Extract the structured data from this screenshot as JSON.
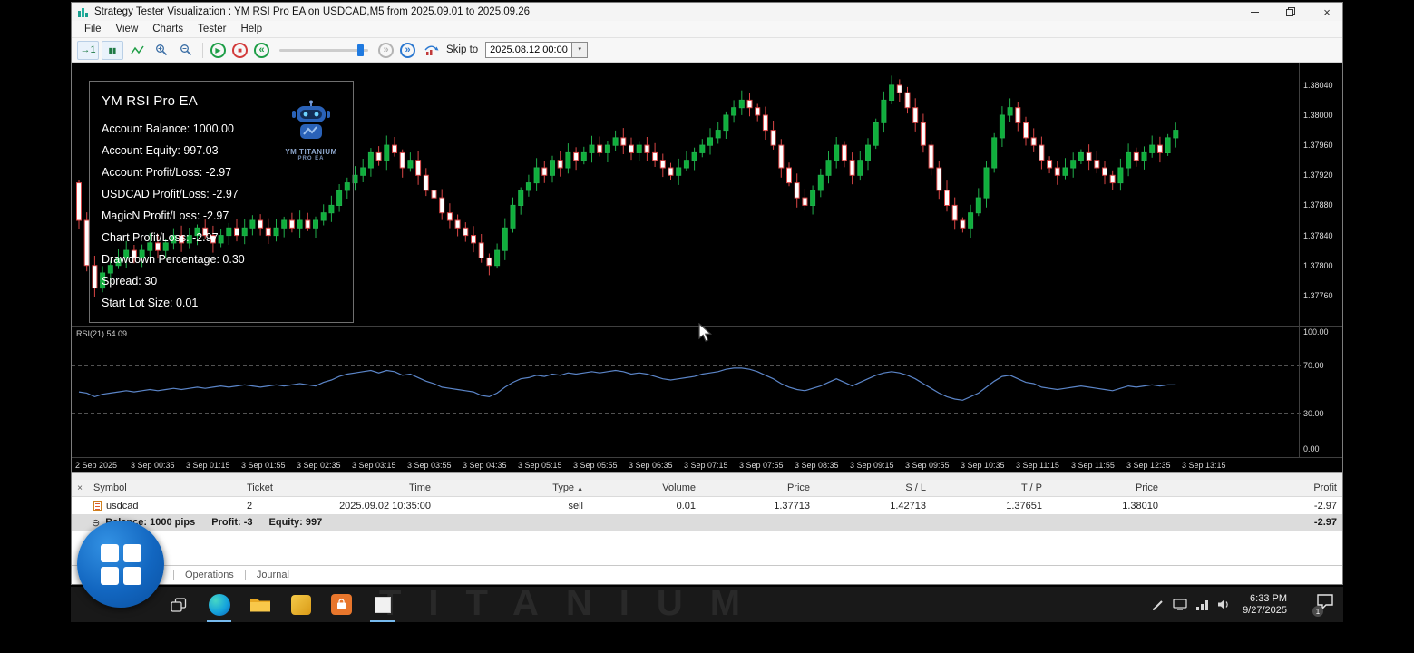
{
  "titlebar": {
    "title": "Strategy Tester Visualization : YM RSI Pro EA on USDCAD,M5 from 2025.09.01 to 2025.09.26"
  },
  "icons": {
    "close": "×",
    "table_close": "×",
    "sort_asc": "▲",
    "collapse": "⊖",
    "step": "→1",
    "pause": "▮▮",
    "play": "▶",
    "stop": "■",
    "rewind": "«",
    "forward": "»",
    "skip_end": "»",
    "dropdown": "▼"
  },
  "menu": {
    "items": [
      "File",
      "View",
      "Charts",
      "Tester",
      "Help"
    ]
  },
  "toolbar": {
    "skip_to": "Skip to",
    "date_value": "2025.08.12 00:00"
  },
  "ea_panel": {
    "title": "YM RSI Pro EA",
    "logo_line1": "YM TITANIUM",
    "logo_line2": "PRO EA",
    "lines": [
      "Account Balance: 1000.00",
      "Account Equity: 997.03",
      "Account Profit/Loss: -2.97",
      "USDCAD Profit/Loss: -2.97",
      "MagicN Profit/Loss: -2.97",
      "Chart Profit/Loss: -2.97",
      "Drawdown Percentage: 0.30",
      "Spread: 30",
      "Start Lot Size: 0.01"
    ]
  },
  "chart_data": {
    "type": "candlestick",
    "symbol": "USDCAD",
    "timeframe": "M5",
    "price_range": [
      1.3772,
      1.3807
    ],
    "price_axis_labels": [
      "1.38040",
      "1.38000",
      "1.37960",
      "1.37920",
      "1.37880",
      "1.37840",
      "1.37800",
      "1.37760"
    ],
    "closes": [
      1.3786,
      1.378,
      1.3777,
      1.3779,
      1.378,
      1.3781,
      1.3782,
      1.3781,
      1.3782,
      1.3783,
      1.3782,
      1.3783,
      1.3784,
      1.3783,
      1.3784,
      1.3785,
      1.3784,
      1.3783,
      1.3784,
      1.3785,
      1.3784,
      1.3785,
      1.3786,
      1.3785,
      1.3784,
      1.3785,
      1.3786,
      1.3785,
      1.3786,
      1.3785,
      1.3786,
      1.3787,
      1.3788,
      1.379,
      1.3791,
      1.3792,
      1.3793,
      1.3795,
      1.3794,
      1.3796,
      1.3795,
      1.3793,
      1.3794,
      1.3792,
      1.379,
      1.3789,
      1.3787,
      1.3786,
      1.3785,
      1.3784,
      1.3783,
      1.3781,
      1.378,
      1.3782,
      1.3785,
      1.3788,
      1.379,
      1.3791,
      1.3793,
      1.3792,
      1.3794,
      1.3793,
      1.3795,
      1.3794,
      1.3795,
      1.3796,
      1.3795,
      1.3796,
      1.3797,
      1.3796,
      1.3795,
      1.3796,
      1.3795,
      1.3794,
      1.3793,
      1.3792,
      1.3793,
      1.3794,
      1.3795,
      1.3796,
      1.3797,
      1.3798,
      1.38,
      1.3801,
      1.3802,
      1.3801,
      1.38,
      1.3798,
      1.3796,
      1.3793,
      1.3791,
      1.3789,
      1.3788,
      1.379,
      1.3792,
      1.3794,
      1.3796,
      1.3794,
      1.3792,
      1.3794,
      1.3796,
      1.3799,
      1.3802,
      1.3804,
      1.3803,
      1.3801,
      1.3799,
      1.3796,
      1.3793,
      1.379,
      1.3788,
      1.3786,
      1.3785,
      1.3787,
      1.3789,
      1.3793,
      1.3797,
      1.38,
      1.3801,
      1.3799,
      1.3797,
      1.3796,
      1.3794,
      1.3793,
      1.3792,
      1.3793,
      1.3794,
      1.3795,
      1.3794,
      1.3793,
      1.3792,
      1.3791,
      1.3793,
      1.3795,
      1.3794,
      1.3795,
      1.3796,
      1.3795,
      1.3797,
      1.3798
    ],
    "rsi_label": "RSI(21) 54.09",
    "rsi_levels": [
      70,
      30
    ],
    "rsi_axis_labels": [
      "100.00",
      "70.00",
      "30.00",
      "0.00"
    ],
    "rsi_axis_values": [
      100,
      70,
      30,
      0
    ],
    "rsi_values": [
      48,
      47,
      44,
      46,
      47,
      48,
      49,
      48,
      49,
      50,
      49,
      50,
      51,
      50,
      51,
      52,
      51,
      52,
      53,
      52,
      53,
      54,
      53,
      52,
      53,
      54,
      53,
      54,
      55,
      54,
      53,
      56,
      58,
      61,
      63,
      64,
      65,
      66,
      64,
      66,
      65,
      62,
      63,
      60,
      57,
      55,
      52,
      51,
      50,
      49,
      48,
      45,
      44,
      47,
      52,
      56,
      59,
      60,
      62,
      61,
      63,
      62,
      64,
      63,
      64,
      65,
      64,
      65,
      66,
      65,
      63,
      64,
      63,
      61,
      59,
      58,
      59,
      60,
      61,
      63,
      64,
      65,
      67,
      68,
      68,
      67,
      65,
      62,
      59,
      55,
      52,
      50,
      49,
      51,
      53,
      56,
      59,
      56,
      53,
      56,
      59,
      62,
      64,
      65,
      64,
      62,
      59,
      55,
      51,
      47,
      44,
      42,
      41,
      44,
      47,
      52,
      57,
      61,
      62,
      59,
      56,
      55,
      52,
      51,
      50,
      51,
      52,
      53,
      52,
      51,
      50,
      49,
      51,
      53,
      52,
      53,
      54,
      53,
      54,
      54
    ],
    "time_labels": [
      "2 Sep 2025",
      "3 Sep 00:35",
      "3 Sep 01:15",
      "3 Sep 01:55",
      "3 Sep 02:35",
      "3 Sep 03:15",
      "3 Sep 03:55",
      "3 Sep 04:35",
      "3 Sep 05:15",
      "3 Sep 05:55",
      "3 Sep 06:35",
      "3 Sep 07:15",
      "3 Sep 07:55",
      "3 Sep 08:35",
      "3 Sep 09:15",
      "3 Sep 09:55",
      "3 Sep 10:35",
      "3 Sep 11:15",
      "3 Sep 11:55",
      "3 Sep 12:35",
      "3 Sep 13:15"
    ],
    "colors": {
      "bull": "#0faf3c",
      "bear_body": "#ffffff",
      "bear_edge": "#d94545",
      "rsi_line": "#5b85c8"
    }
  },
  "trade_table": {
    "headers": [
      "Symbol",
      "Ticket",
      "Time",
      "Type",
      "Volume",
      "Price",
      "S / L",
      "T / P",
      "Price",
      "Profit"
    ],
    "row": {
      "symbol": "usdcad",
      "ticket": "2",
      "time": "2025.09.02 10:35:00",
      "type": "sell",
      "volume": "0.01",
      "price": "1.37713",
      "sl": "1.42713",
      "tp": "1.37651",
      "close_price": "1.38010",
      "profit": "-2.97"
    },
    "balance": {
      "part1": "Balance: 1000 pips",
      "part2": "Profit: -3",
      "part3": "Equity: 997",
      "profit": "-2.97"
    }
  },
  "tabs": {
    "items": [
      "Operations",
      "Journal"
    ]
  },
  "taskbar": {
    "time": "6:33 PM",
    "date": "9/27/2025",
    "notification_count": "1"
  }
}
